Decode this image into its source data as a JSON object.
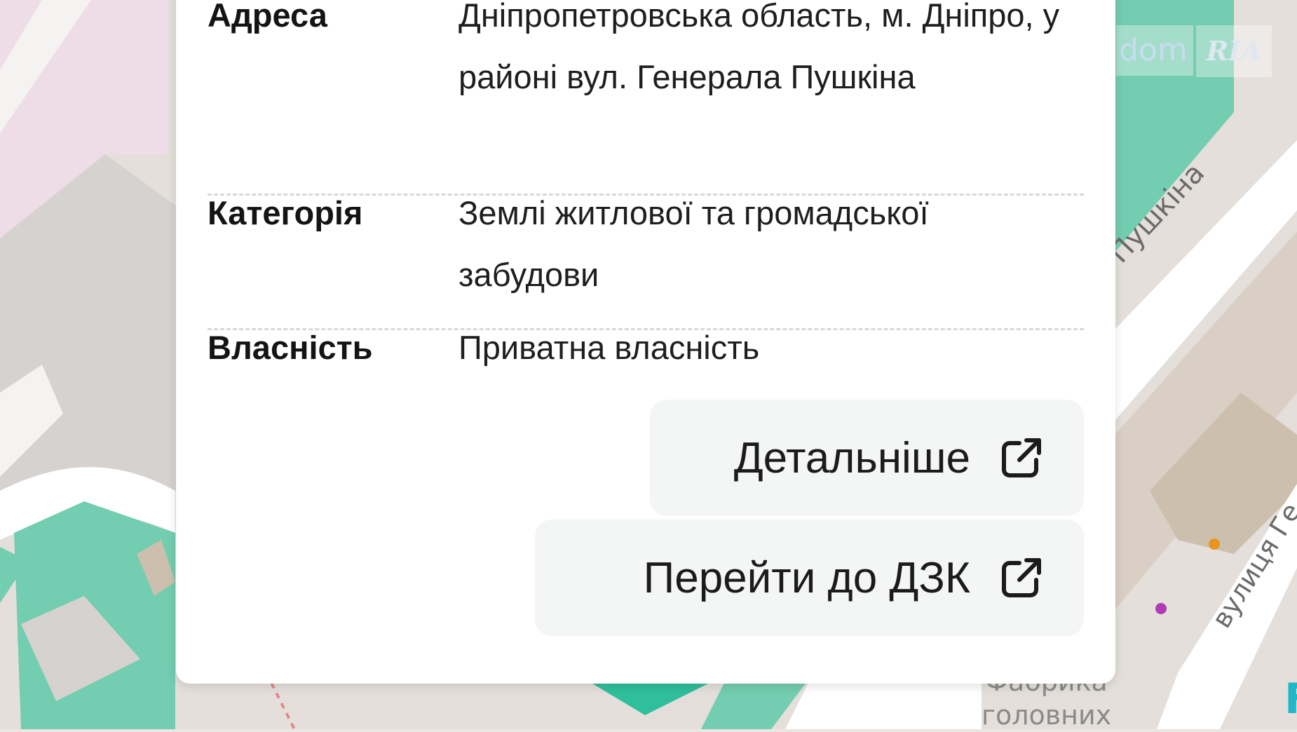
{
  "map": {
    "labels": {
      "street_pushkina": "а Пушкіна",
      "street_general": "вулиця Ге",
      "poi_line1": "Фабрика",
      "poi_line2": "головних"
    },
    "watermark": {
      "dom": "dom",
      "ria": "RIA"
    },
    "edge_mark": "F",
    "colors": {
      "green": "#73cdb0",
      "pink": "#eedde6",
      "road": "#ffffff",
      "building": "#d9cfc5",
      "gray": "#d5d2cf"
    }
  },
  "popup": {
    "rows": [
      {
        "label": "Адреса",
        "value": "Дніпропетровська область, м. Дніпро, у районі вул. Генерала Пушкіна"
      },
      {
        "label": "Категорія",
        "value": "Землі житлової та громадської забудови"
      },
      {
        "label": "Власність",
        "value": "Приватна власність"
      }
    ],
    "buttons": {
      "details": {
        "label": "Детальніше",
        "icon": "external-link-icon"
      },
      "dzk": {
        "label": "Перейти до ДЗК",
        "icon": "external-link-icon"
      }
    }
  }
}
